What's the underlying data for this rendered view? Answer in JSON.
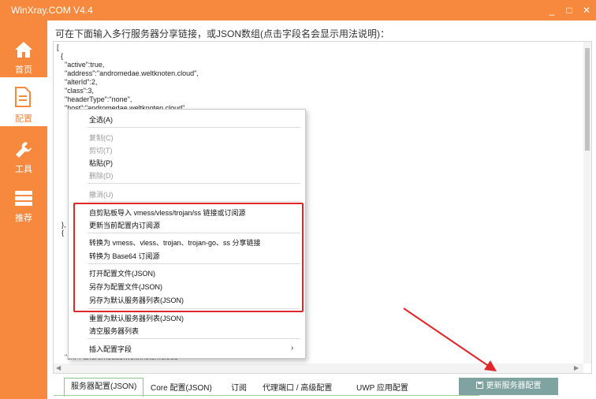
{
  "window": {
    "title": "WinXray.COM   V4.4",
    "min": "_",
    "max": "□",
    "close": "✕"
  },
  "sidebar": {
    "items": [
      {
        "label": "首页",
        "icon": "home-icon"
      },
      {
        "label": "配置",
        "icon": "document-icon"
      },
      {
        "label": "工具",
        "icon": "wrench-icon"
      },
      {
        "label": "推荐",
        "icon": "server-icon"
      }
    ]
  },
  "main": {
    "instruction": "可在下面输入多行服务器分享链接，或JSON数组(点击字段名会显示用法说明)：",
    "code": "[\n  {\n    \"active\":true,\n    \"address\":\"andromedae.weltknoten.cloud\",\n    \"alterId\":2,\n    \"class\":3,\n    \"headerType\":\"none\",\n    \"host\":\"andromedae.weltknoten.cloud\",",
    "code_partial_left_1": "},",
    "code_partial_left_2": "{",
    "code_bottom_line": "    \"sni\":\"andromedae.weltknoten.cloud\"",
    "hscroll_left": "◀",
    "hscroll_right": "▶"
  },
  "context_menu": {
    "items": [
      {
        "label": "全选(A)",
        "enabled": true
      },
      {
        "label": "复制(C)",
        "enabled": false
      },
      {
        "label": "剪切(T)",
        "enabled": false
      },
      {
        "label": "粘贴(P)",
        "enabled": true
      },
      {
        "label": "删除(D)",
        "enabled": false
      },
      {
        "label": "撤消(U)",
        "enabled": false
      },
      {
        "label": "自剪贴板导入 vmess/vless/trojan/ss 链接或订阅源",
        "enabled": true
      },
      {
        "label": "更新当前配置内订阅源",
        "enabled": true
      },
      {
        "label": "转换为 vmess、vless、trojan、trojan-go、ss 分享链接",
        "enabled": true
      },
      {
        "label": "转换为 Base64 订阅源",
        "enabled": true
      },
      {
        "label": "打开配置文件(JSON)",
        "enabled": true
      },
      {
        "label": "另存为配置文件(JSON)",
        "enabled": true
      },
      {
        "label": "另存为默认服务器列表(JSON)",
        "enabled": true
      },
      {
        "label": "重置为默认服务器列表(JSON)",
        "enabled": true
      },
      {
        "label": "清空服务器列表",
        "enabled": true
      },
      {
        "label": "插入配置字段",
        "enabled": true
      }
    ],
    "submenu_arrow": "›"
  },
  "tabs": [
    "服务器配置(JSON)",
    "Core 配置(JSON)",
    "订阅",
    "代理端口 / 高级配置",
    "UWP 应用配置"
  ],
  "update_button": {
    "icon": "save-icon",
    "label": "更新服务器配置"
  },
  "colors": {
    "accent": "#f6893d",
    "highlight_box": "#e0262b",
    "arrow": "#e0262b",
    "button": "#7fa3a0"
  }
}
